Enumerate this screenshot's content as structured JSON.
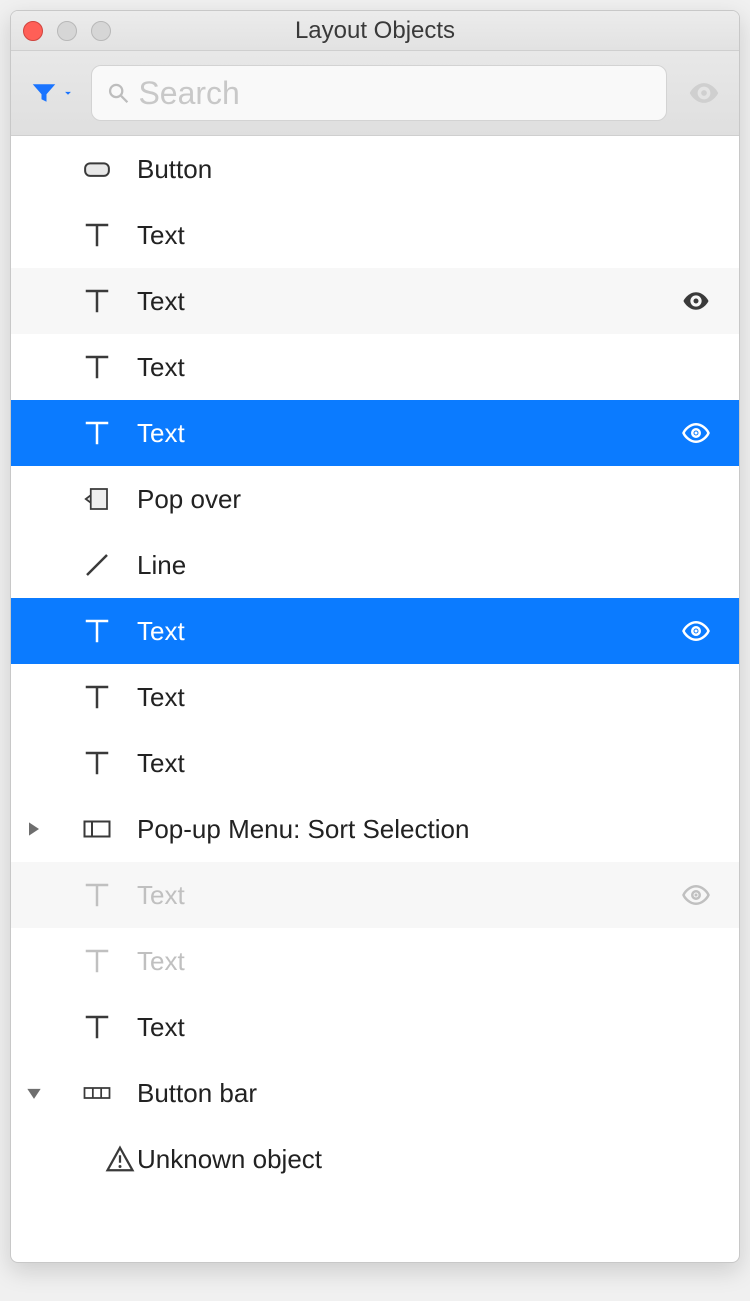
{
  "window": {
    "title": "Layout Objects"
  },
  "toolbar": {
    "search_placeholder": "Search",
    "search_value": ""
  },
  "colors": {
    "selection": "#0b7bff"
  },
  "rows": [
    {
      "icon": "button",
      "label": "Button",
      "eye": false,
      "selected": false,
      "striped": false,
      "hidden": false,
      "disclose": null,
      "indent": 0
    },
    {
      "icon": "text",
      "label": "Text",
      "eye": false,
      "selected": false,
      "striped": false,
      "hidden": false,
      "disclose": null,
      "indent": 0
    },
    {
      "icon": "text",
      "label": "Text",
      "eye": true,
      "selected": false,
      "striped": true,
      "hidden": false,
      "disclose": null,
      "indent": 0
    },
    {
      "icon": "text",
      "label": "Text",
      "eye": false,
      "selected": false,
      "striped": false,
      "hidden": false,
      "disclose": null,
      "indent": 0
    },
    {
      "icon": "text",
      "label": "Text",
      "eye": true,
      "selected": true,
      "striped": false,
      "hidden": false,
      "disclose": null,
      "indent": 0
    },
    {
      "icon": "popover",
      "label": "Pop over",
      "eye": false,
      "selected": false,
      "striped": false,
      "hidden": false,
      "disclose": null,
      "indent": 0
    },
    {
      "icon": "line",
      "label": "Line",
      "eye": false,
      "selected": false,
      "striped": false,
      "hidden": false,
      "disclose": null,
      "indent": 0
    },
    {
      "icon": "text",
      "label": "Text",
      "eye": true,
      "selected": true,
      "striped": false,
      "hidden": false,
      "disclose": null,
      "indent": 0
    },
    {
      "icon": "text",
      "label": "Text",
      "eye": false,
      "selected": false,
      "striped": false,
      "hidden": false,
      "disclose": null,
      "indent": 0
    },
    {
      "icon": "text",
      "label": "Text",
      "eye": false,
      "selected": false,
      "striped": false,
      "hidden": false,
      "disclose": null,
      "indent": 0
    },
    {
      "icon": "popup",
      "label": "Pop-up Menu: Sort Selection",
      "eye": false,
      "selected": false,
      "striped": false,
      "hidden": false,
      "disclose": "right",
      "indent": 0
    },
    {
      "icon": "text",
      "label": "Text",
      "eye": true,
      "selected": false,
      "striped": true,
      "hidden": true,
      "disclose": null,
      "indent": 0
    },
    {
      "icon": "text",
      "label": "Text",
      "eye": false,
      "selected": false,
      "striped": false,
      "hidden": true,
      "disclose": null,
      "indent": 0
    },
    {
      "icon": "text",
      "label": "Text",
      "eye": false,
      "selected": false,
      "striped": false,
      "hidden": false,
      "disclose": null,
      "indent": 0
    },
    {
      "icon": "buttonbar",
      "label": "Button bar",
      "eye": false,
      "selected": false,
      "striped": false,
      "hidden": false,
      "disclose": "down",
      "indent": 0
    },
    {
      "icon": "warning",
      "label": "Unknown object",
      "eye": false,
      "selected": false,
      "striped": false,
      "hidden": false,
      "disclose": null,
      "indent": 1
    }
  ]
}
